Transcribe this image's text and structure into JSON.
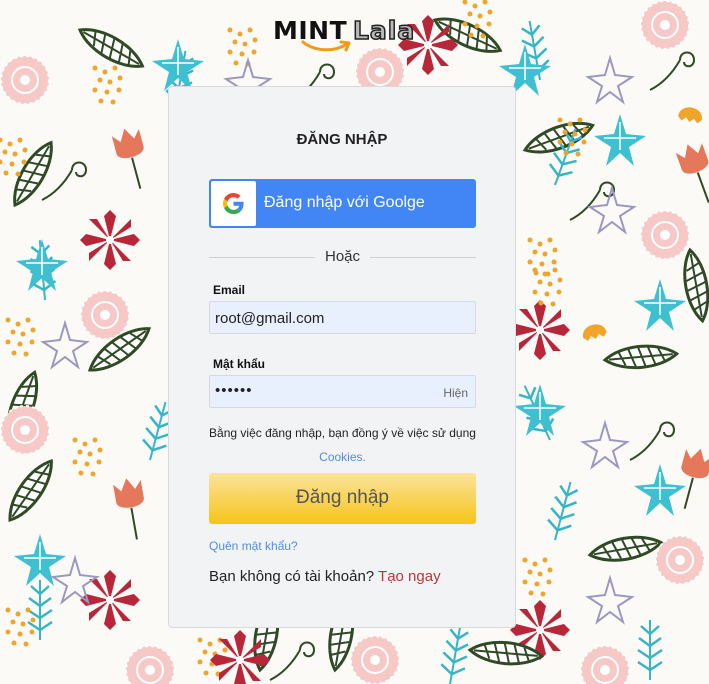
{
  "logo": {
    "mint_text": "MINT",
    "lala_text": "Lala"
  },
  "login": {
    "title": "ĐĂNG NHẬP",
    "google_button_label": "Đăng nhập với Goolge",
    "divider_text": "Hoặc",
    "email_label": "Email",
    "email_value": "root@gmail.com",
    "password_label": "Mật khẩu",
    "password_value": "••••••",
    "show_password_label": "Hiện",
    "terms_text": "Bằng việc đăng nhập, bạn đồng ý về việc sử dụng",
    "cookies_link": "Cookies.",
    "submit_label": "Đăng nhập",
    "forgot_password_link": "Quên mật khẩu?",
    "no_account_text": "Bạn không có tài khoản?",
    "signup_link": "Tạo ngay"
  },
  "colors": {
    "google_blue": "#4285f4",
    "submit_gradient_top": "#fbe49b",
    "submit_gradient_bottom": "#f6c419",
    "link_blue": "#4f8fdd",
    "link_red": "#b33a3a",
    "card_background": "#f2f3f5",
    "input_background": "#e8f0fe"
  },
  "icons": {
    "google": "google-g-icon",
    "logo_smile": "smile-arrow-icon"
  }
}
